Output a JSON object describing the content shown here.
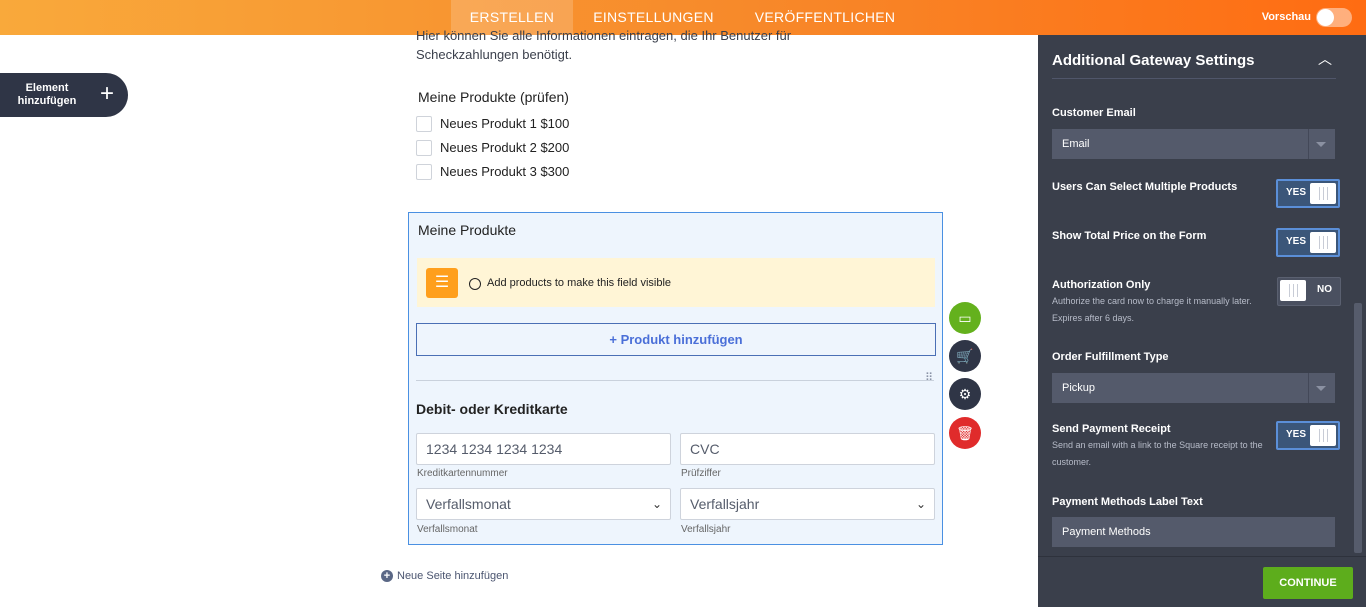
{
  "topbar": {
    "tabs": [
      {
        "label": "ERSTELLEN",
        "active": true
      },
      {
        "label": "EINSTELLUNGEN",
        "active": false
      },
      {
        "label": "VERÖFFENTLICHEN",
        "active": false
      }
    ],
    "preview_label": "Vorschau",
    "preview_on": false
  },
  "add_element": {
    "label": "Element hinzufügen",
    "icon": "plus-icon"
  },
  "form": {
    "intro_text": "Hier können Sie alle Informationen eintragen, die Ihr Benutzer für Scheckzahlungen benötigt.",
    "products_check": {
      "title": "Meine Produkte (prüfen)",
      "items": [
        "Neues Produkt 1 $100",
        "Neues Produkt 2 $200",
        "Neues Produkt 3 $300"
      ]
    },
    "products": {
      "title": "Meine Produkte",
      "notice": "Add products to make this field visible",
      "add_button": "+ Produkt hinzufügen"
    },
    "card": {
      "title": "Debit- oder Kreditkarte",
      "number_placeholder": "1234 1234 1234 1234",
      "number_label": "Kreditkartennummer",
      "cvc_placeholder": "CVC",
      "cvc_label": "Prüfziffer",
      "month_value": "Verfallsmonat",
      "month_label": "Verfallsmonat",
      "year_value": "Verfallsjahr",
      "year_label": "Verfallsjahr"
    },
    "new_page": "Neue Seite hinzufügen"
  },
  "fabs": [
    {
      "name": "payment-card-icon",
      "color": "#64b11d"
    },
    {
      "name": "cart-icon",
      "color": "#2f3546"
    },
    {
      "name": "gear-icon",
      "color": "#2f3546"
    },
    {
      "name": "trash-icon",
      "color": "#e02b2b"
    }
  ],
  "panel": {
    "title": "Additional Gateway Settings",
    "customer_email": {
      "label": "Customer Email",
      "value": "Email"
    },
    "multiple_products": {
      "label": "Users Can Select Multiple Products",
      "state": "YES"
    },
    "show_total": {
      "label": "Show Total Price on the Form",
      "state": "YES"
    },
    "authorization": {
      "label": "Authorization Only",
      "desc": "Authorize the card now to charge it manually later. Expires after 6 days.",
      "state": "NO"
    },
    "fulfillment": {
      "label": "Order Fulfillment Type",
      "value": "Pickup"
    },
    "receipt": {
      "label": "Send Payment Receipt",
      "desc": "Send an email with a link to the Square receipt to the customer.",
      "state": "YES"
    },
    "methods_label": {
      "label": "Payment Methods Label Text",
      "value": "Payment Methods"
    },
    "continue": "CONTINUE"
  },
  "colors": {
    "accent": "#ff7a1a",
    "panel_bg": "#3a3f4b",
    "continue_green": "#5dad1c",
    "selection_blue": "#4a90e2"
  }
}
